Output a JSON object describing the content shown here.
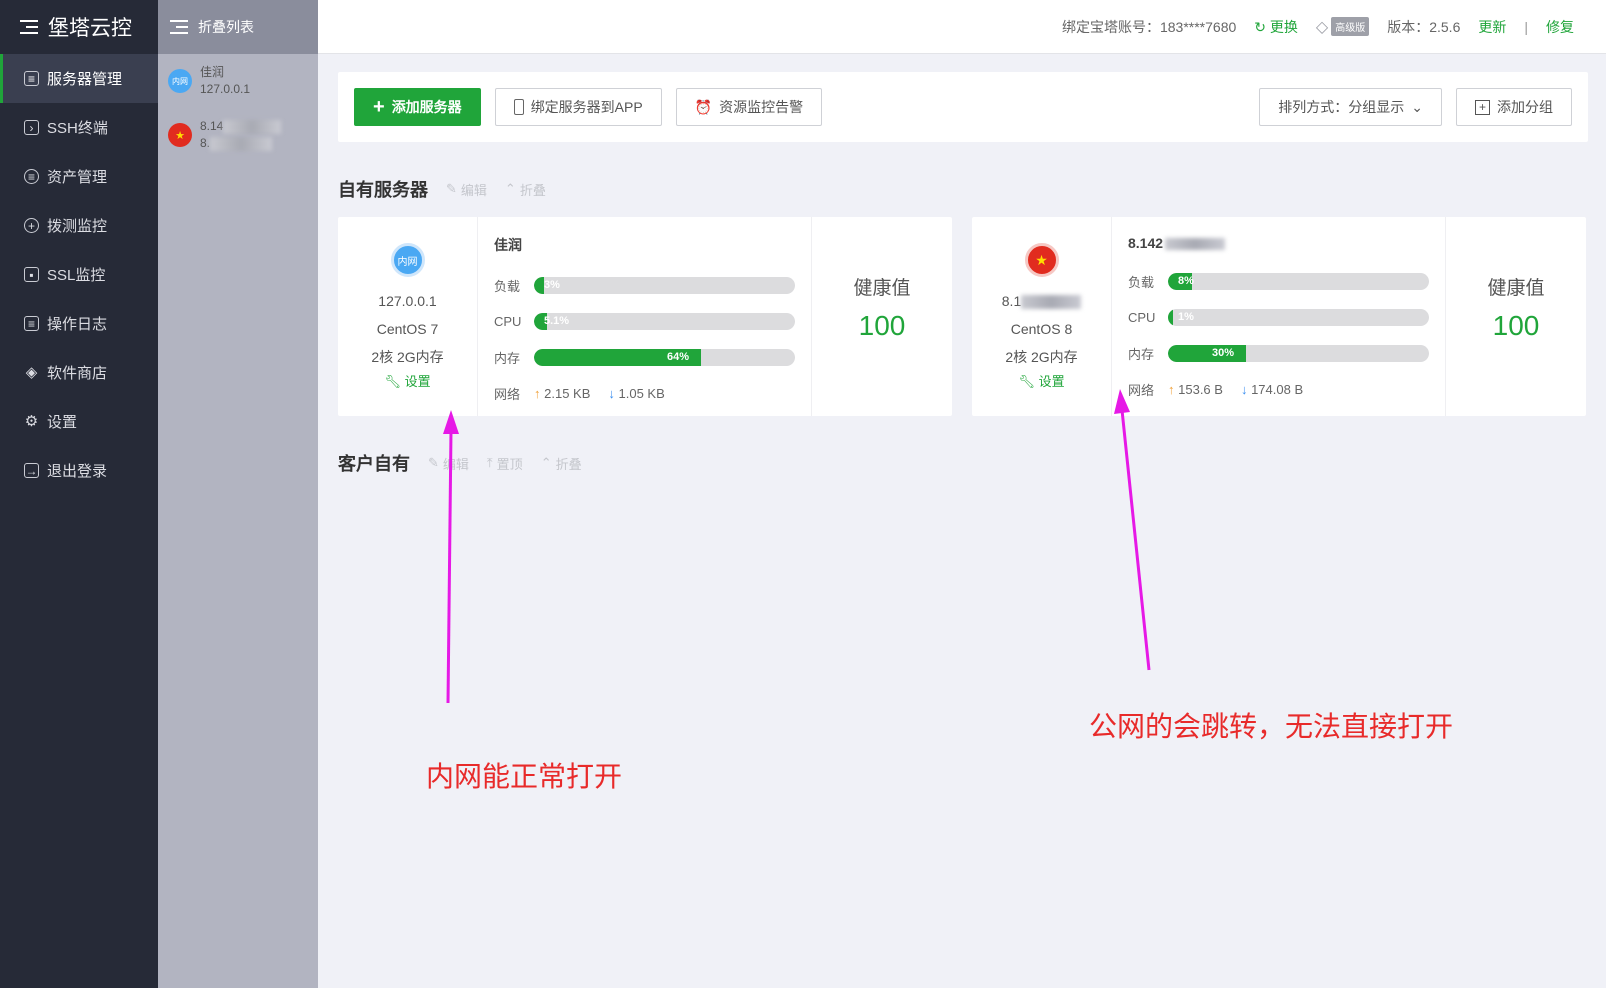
{
  "brand": {
    "title": "堡塔云控"
  },
  "sidebar": {
    "items": [
      {
        "label": "服务器管理",
        "icon": "server-list-icon"
      },
      {
        "label": "SSH终端",
        "icon": "terminal-icon"
      },
      {
        "label": "资产管理",
        "icon": "database-icon"
      },
      {
        "label": "拨测监控",
        "icon": "globe-icon"
      },
      {
        "label": "SSL监控",
        "icon": "certificate-icon"
      },
      {
        "label": "操作日志",
        "icon": "log-icon"
      },
      {
        "label": "软件商店",
        "icon": "layers-icon"
      },
      {
        "label": "设置",
        "icon": "gear-icon"
      },
      {
        "label": "退出登录",
        "icon": "logout-icon"
      }
    ]
  },
  "foldlist": {
    "title": "折叠列表",
    "items": [
      {
        "avatar": "内网",
        "line1": "佳润",
        "line2": "127.0.0.1"
      },
      {
        "avatar": "★",
        "line1": "8.14",
        "line2": "8."
      }
    ]
  },
  "topbar": {
    "account_label": "绑定宝塔账号：183****7680",
    "change_label": "更换",
    "edition_badge": "高级版",
    "version_label": "版本：2.5.6",
    "update_label": "更新",
    "divider": "|",
    "repair_label": "修复"
  },
  "toolbar": {
    "add_server": "添加服务器",
    "bind_app": "绑定服务器到APP",
    "monitor_alert": "资源监控告警",
    "sort_label": "排列方式：分组显示",
    "add_group": "添加分组"
  },
  "groups": {
    "own": {
      "title": "自有服务器",
      "edit": "编辑",
      "fold": "折叠"
    },
    "client": {
      "title": "客户自有",
      "edit": "编辑",
      "top": "置顶",
      "fold": "折叠"
    }
  },
  "servers": [
    {
      "avatar": "内网",
      "ip": "127.0.0.1",
      "os": "CentOS 7",
      "spec": "2核 2G内存",
      "setting": "设置",
      "name": "佳润",
      "metric_labels": {
        "load": "负载",
        "cpu": "CPU",
        "mem": "内存",
        "net": "网络"
      },
      "load": "3%",
      "load_value": 3,
      "cpu": "5.1%",
      "cpu_value": 5.1,
      "mem": "64%",
      "mem_value": 64,
      "net_up": "2.15 KB",
      "net_down": "1.05 KB",
      "health_label": "健康值",
      "health_value": "100"
    },
    {
      "avatar": "★",
      "ip": "8.1",
      "os": "CentOS 8",
      "spec": "2核 2G内存",
      "setting": "设置",
      "name": "8.142",
      "metric_labels": {
        "load": "负载",
        "cpu": "CPU",
        "mem": "内存",
        "net": "网络"
      },
      "load": "8%",
      "load_value": 8,
      "cpu": "1%",
      "cpu_value": 1,
      "mem": "30%",
      "mem_value": 30,
      "net_up": "153.6 B",
      "net_down": "174.08 B",
      "health_label": "健康值",
      "health_value": "100"
    }
  ],
  "annotations": {
    "left": "内网能正常打开",
    "right": "公网的会跳转，无法直接打开",
    "color": "#e82a2a",
    "arrow_color": "#e619e6"
  },
  "colors": {
    "accent": "#20a53a",
    "sidebar_bg": "#262a37"
  }
}
